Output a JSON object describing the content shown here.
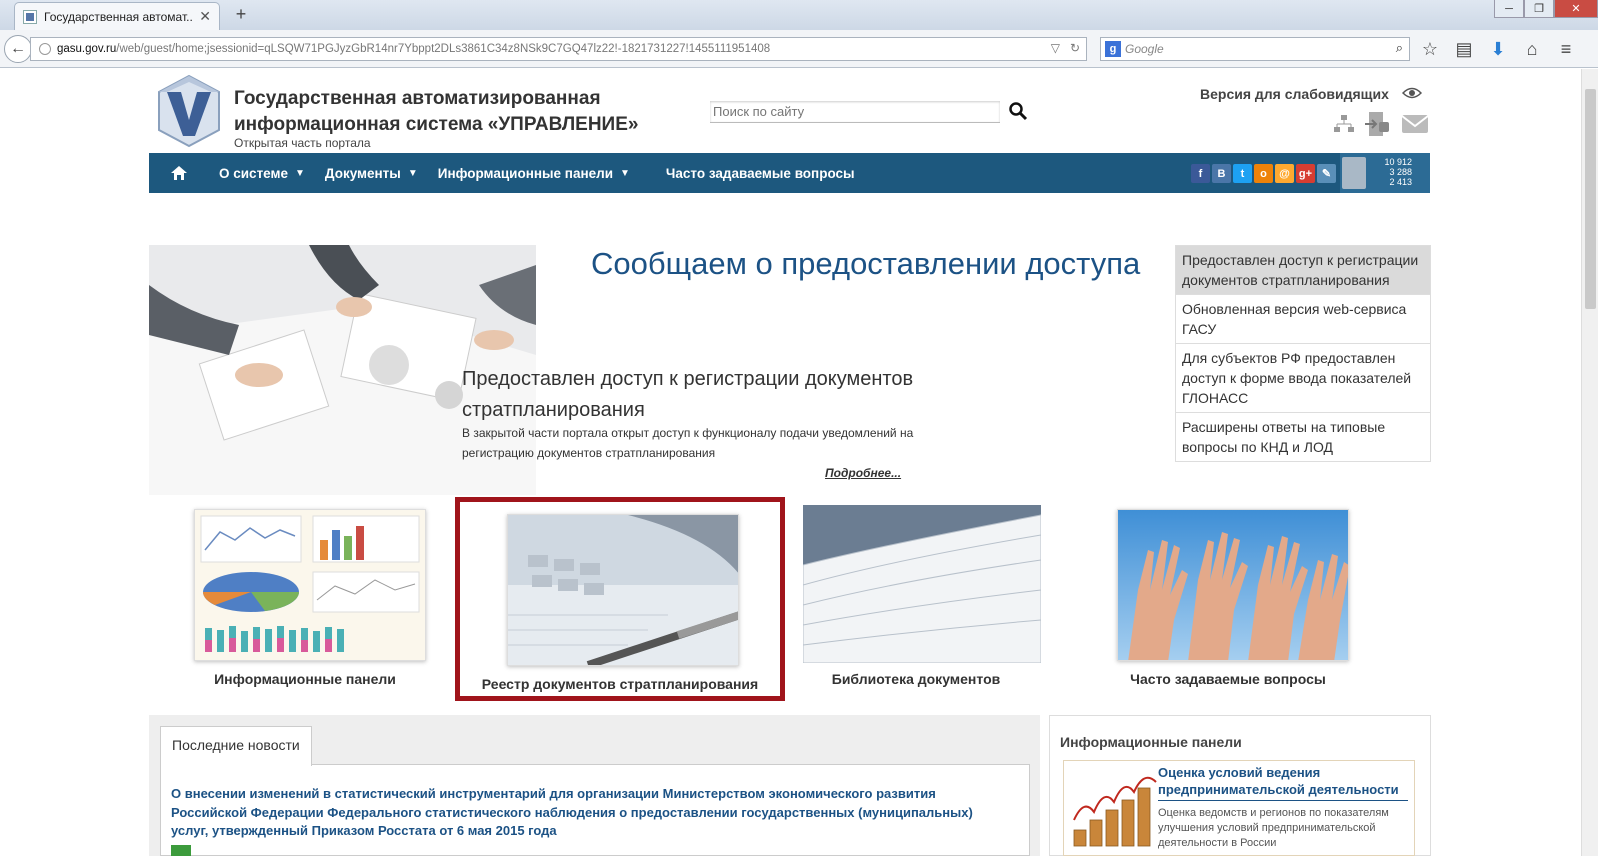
{
  "browser": {
    "tab_title": "Государственная автомат...",
    "tab_close": "✕",
    "new_tab": "+",
    "url_host": "gasu.gov.ru",
    "url_path": "/web/guest/home;jsessionid=qLSQW71PGJyzGbR14nr7Ybppt2DLs3861C34z8NSk9C7GQ47lz22!-1821731227!1455111951408",
    "search_placeholder": "Google",
    "window_controls": [
      "─",
      "❐",
      "✕"
    ]
  },
  "header": {
    "title": "Государственная автоматизированная информационная система «УПРАВЛЕНИЕ»",
    "subtitle": "Открытая часть портала",
    "search_placeholder": "Поиск по сайту",
    "accessibility_link": "Версия для слабовидящих"
  },
  "nav": {
    "items": [
      {
        "label": "О системе",
        "has_dropdown": true
      },
      {
        "label": "Документы",
        "has_dropdown": true
      },
      {
        "label": "Информационные панели",
        "has_dropdown": true
      },
      {
        "label": "Часто задаваемые вопросы",
        "has_dropdown": false
      }
    ],
    "social": [
      {
        "label": "f",
        "color": "#3b5998"
      },
      {
        "label": "B",
        "color": "#4a76a8"
      },
      {
        "label": "t",
        "color": "#1da1f2"
      },
      {
        "label": "o",
        "color": "#ee8208"
      },
      {
        "label": "@",
        "color": "#ffa930"
      },
      {
        "label": "g+",
        "color": "#d73d32"
      },
      {
        "label": "✎",
        "color": "#5a8fb8"
      }
    ],
    "stats": [
      "10 912",
      "3 288",
      "2 413"
    ]
  },
  "banner": {
    "headline": "Сообщаем о предоставлении доступа",
    "slide_title": "Предоставлен доступ к регистрации документов стратпланирования",
    "slide_desc": "В закрытой части портала открыт доступ к функционалу подачи уведомлений на регистрацию документов стратпланирования",
    "slide_more": "Подробнее...",
    "news_items": [
      "Предоставлен доступ к регистрации документов стратпланирования",
      "Обновленная версия web-сервиса ГАСУ",
      "Для субъектов РФ предоставлен доступ к форме ввода показателей ГЛОНАСС",
      "Расширены ответы на типовые вопросы по КНД и ЛОД"
    ]
  },
  "cards": [
    {
      "label": "Информационные панели"
    },
    {
      "label": "Реестр документов стратпланирования"
    },
    {
      "label": "Библиотека документов"
    },
    {
      "label": "Часто задаваемые вопросы"
    }
  ],
  "news": {
    "tab_label": "Последние новости",
    "headline": "О внесении изменений в статистический инструментарий для организации Министерством экономического развития Российской Федерации Федерального статистического наблюдения о предоставлении государственных (муниципальных) услуг, утвержденный Приказом Росстата от 6 мая 2015 года"
  },
  "panels": {
    "heading": "Информационные панели",
    "card_title": "Оценка условий ведения предпринимательской деятельности",
    "card_desc": "Оценка ведомств и регионов по показателям улучшения условий предпринимательской деятельности в России"
  }
}
